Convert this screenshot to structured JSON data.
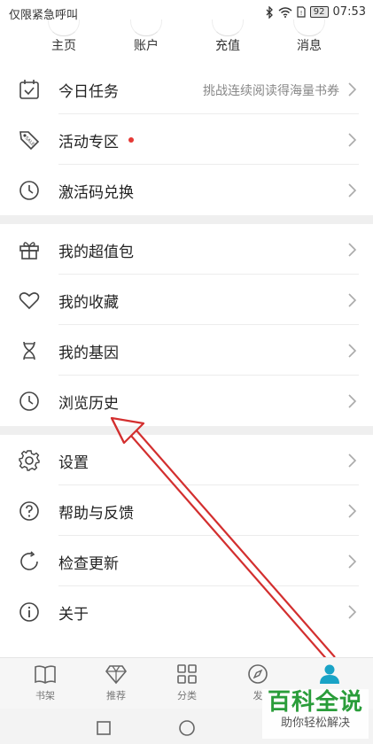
{
  "status_bar": {
    "left_text": "仅限紧急呼叫",
    "battery": "92",
    "time": "07:53"
  },
  "top_tabs": [
    {
      "label": "主页"
    },
    {
      "label": "账户"
    },
    {
      "label": "充值"
    },
    {
      "label": "消息"
    }
  ],
  "menu": {
    "group1": [
      {
        "label": "今日任务",
        "hint": "挑战连续阅读得海量书券",
        "icon": "calendar-check-icon"
      },
      {
        "label": "活动专区",
        "icon": "tag-sale-icon",
        "badge": "red-dot"
      },
      {
        "label": "激活码兑换",
        "icon": "clock-icon"
      }
    ],
    "group2": [
      {
        "label": "我的超值包",
        "icon": "gift-icon"
      },
      {
        "label": "我的收藏",
        "icon": "heart-icon"
      },
      {
        "label": "我的基因",
        "icon": "dna-icon"
      },
      {
        "label": "浏览历史",
        "icon": "history-clock-icon"
      }
    ],
    "group3": [
      {
        "label": "设置",
        "icon": "gear-icon"
      },
      {
        "label": "帮助与反馈",
        "icon": "question-circle-icon"
      },
      {
        "label": "检查更新",
        "icon": "refresh-icon"
      },
      {
        "label": "关于",
        "icon": "info-circle-icon"
      }
    ]
  },
  "bottom_nav": [
    {
      "label": "书架",
      "icon": "book-icon"
    },
    {
      "label": "推荐",
      "icon": "diamond-icon"
    },
    {
      "label": "分类",
      "icon": "grid-icon"
    },
    {
      "label": "发",
      "icon": "compass-icon"
    },
    {
      "label": "",
      "icon": "person-icon",
      "active": true
    }
  ],
  "watermark": {
    "main": "百科全说",
    "sub": "助你轻松解决"
  },
  "colors": {
    "accent": "#1aa3c6",
    "red_dot": "#e53935",
    "arrow": "#d32f2f",
    "watermark_green": "#2a9d3a"
  }
}
